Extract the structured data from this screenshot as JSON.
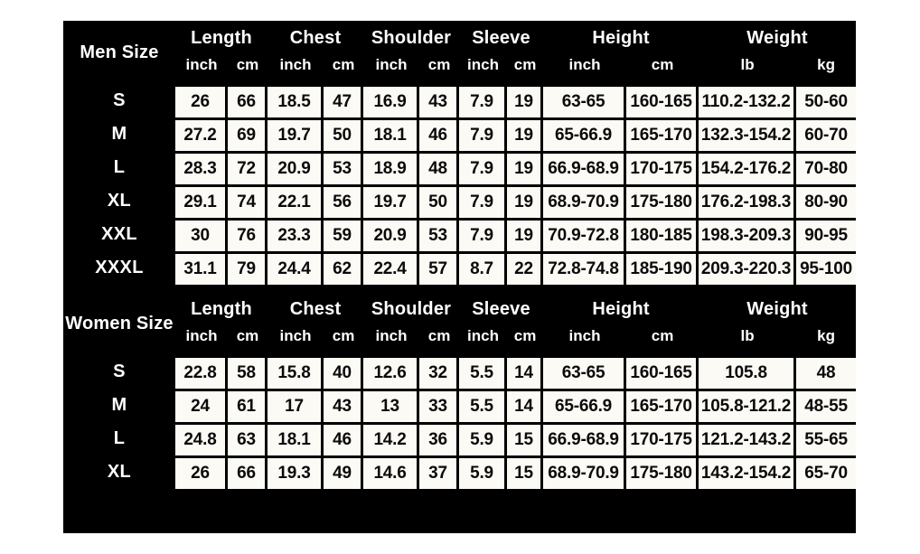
{
  "theme": {
    "panel_background": "#000000",
    "page_background": "#ffffff",
    "cell_background": "#fcfaf5",
    "cell_text": "#0a0a0a",
    "header_text": "#ffffff"
  },
  "groups": {
    "length": "Length",
    "chest": "Chest",
    "shoulder": "Shoulder",
    "sleeve": "Sleeve",
    "height": "Height",
    "weight": "Weight"
  },
  "units": {
    "inch": "inch",
    "cm": "cm",
    "lb": "lb",
    "kg": "kg"
  },
  "sections": [
    {
      "label": "Men Size",
      "rows": [
        {
          "size": "S",
          "length_inch": "26",
          "length_cm": "66",
          "chest_inch": "18.5",
          "chest_cm": "47",
          "shoulder_inch": "16.9",
          "shoulder_cm": "43",
          "sleeve_inch": "7.9",
          "sleeve_cm": "19",
          "height_inch": "63-65",
          "height_cm": "160-165",
          "weight_lb": "110.2-132.2",
          "weight_kg": "50-60"
        },
        {
          "size": "M",
          "length_inch": "27.2",
          "length_cm": "69",
          "chest_inch": "19.7",
          "chest_cm": "50",
          "shoulder_inch": "18.1",
          "shoulder_cm": "46",
          "sleeve_inch": "7.9",
          "sleeve_cm": "19",
          "height_inch": "65-66.9",
          "height_cm": "165-170",
          "weight_lb": "132.3-154.2",
          "weight_kg": "60-70"
        },
        {
          "size": "L",
          "length_inch": "28.3",
          "length_cm": "72",
          "chest_inch": "20.9",
          "chest_cm": "53",
          "shoulder_inch": "18.9",
          "shoulder_cm": "48",
          "sleeve_inch": "7.9",
          "sleeve_cm": "19",
          "height_inch": "66.9-68.9",
          "height_cm": "170-175",
          "weight_lb": "154.2-176.2",
          "weight_kg": "70-80"
        },
        {
          "size": "XL",
          "length_inch": "29.1",
          "length_cm": "74",
          "chest_inch": "22.1",
          "chest_cm": "56",
          "shoulder_inch": "19.7",
          "shoulder_cm": "50",
          "sleeve_inch": "7.9",
          "sleeve_cm": "19",
          "height_inch": "68.9-70.9",
          "height_cm": "175-180",
          "weight_lb": "176.2-198.3",
          "weight_kg": "80-90"
        },
        {
          "size": "XXL",
          "length_inch": "30",
          "length_cm": "76",
          "chest_inch": "23.3",
          "chest_cm": "59",
          "shoulder_inch": "20.9",
          "shoulder_cm": "53",
          "sleeve_inch": "7.9",
          "sleeve_cm": "19",
          "height_inch": "70.9-72.8",
          "height_cm": "180-185",
          "weight_lb": "198.3-209.3",
          "weight_kg": "90-95"
        },
        {
          "size": "XXXL",
          "length_inch": "31.1",
          "length_cm": "79",
          "chest_inch": "24.4",
          "chest_cm": "62",
          "shoulder_inch": "22.4",
          "shoulder_cm": "57",
          "sleeve_inch": "8.7",
          "sleeve_cm": "22",
          "height_inch": "72.8-74.8",
          "height_cm": "185-190",
          "weight_lb": "209.3-220.3",
          "weight_kg": "95-100"
        }
      ]
    },
    {
      "label": "Women Size",
      "rows": [
        {
          "size": "S",
          "length_inch": "22.8",
          "length_cm": "58",
          "chest_inch": "15.8",
          "chest_cm": "40",
          "shoulder_inch": "12.6",
          "shoulder_cm": "32",
          "sleeve_inch": "5.5",
          "sleeve_cm": "14",
          "height_inch": "63-65",
          "height_cm": "160-165",
          "weight_lb": "105.8",
          "weight_kg": "48"
        },
        {
          "size": "M",
          "length_inch": "24",
          "length_cm": "61",
          "chest_inch": "17",
          "chest_cm": "43",
          "shoulder_inch": "13",
          "shoulder_cm": "33",
          "sleeve_inch": "5.5",
          "sleeve_cm": "14",
          "height_inch": "65-66.9",
          "height_cm": "165-170",
          "weight_lb": "105.8-121.2",
          "weight_kg": "48-55"
        },
        {
          "size": "L",
          "length_inch": "24.8",
          "length_cm": "63",
          "chest_inch": "18.1",
          "chest_cm": "46",
          "shoulder_inch": "14.2",
          "shoulder_cm": "36",
          "sleeve_inch": "5.9",
          "sleeve_cm": "15",
          "height_inch": "66.9-68.9",
          "height_cm": "170-175",
          "weight_lb": "121.2-143.2",
          "weight_kg": "55-65"
        },
        {
          "size": "XL",
          "length_inch": "26",
          "length_cm": "66",
          "chest_inch": "19.3",
          "chest_cm": "49",
          "shoulder_inch": "14.6",
          "shoulder_cm": "37",
          "sleeve_inch": "5.9",
          "sleeve_cm": "15",
          "height_inch": "68.9-70.9",
          "height_cm": "175-180",
          "weight_lb": "143.2-154.2",
          "weight_kg": "65-70"
        }
      ]
    }
  ]
}
